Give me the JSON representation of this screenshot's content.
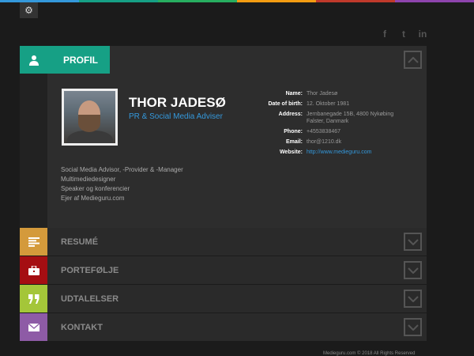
{
  "colors": {
    "topbar": [
      "#3498db",
      "#16a085",
      "#27ae60",
      "#f39c12",
      "#c0392b",
      "#8e44ad"
    ],
    "profil": "#16a085",
    "resume": "#d49a3b",
    "portfolio": "#a50e12",
    "udtalelser": "#a4c639",
    "kontakt": "#8e5ba6"
  },
  "social": {
    "facebook": "f",
    "twitter": "t",
    "linkedin": "in"
  },
  "profile": {
    "tab_label": "PROFIL",
    "name": "THOR JADESØ",
    "title": "PR & Social Media Adviser",
    "info": [
      {
        "key": "Name:",
        "value": "Thor Jadesø"
      },
      {
        "key": "Date of birth:",
        "value": "12. Oktober 1981"
      },
      {
        "key": "Address:",
        "value": "Jernbanegade 15B, 4800 Nykøbing Falster, Danmark"
      },
      {
        "key": "Phone:",
        "value": "+4553838467"
      },
      {
        "key": "Email:",
        "value": "thor@1210.dk"
      },
      {
        "key": "Website:",
        "value": "http://www.medieguru.com"
      }
    ],
    "bio": [
      "Social Media Advisor, -Provider & -Manager",
      "Multimediedesigner",
      "Speaker og konferencier",
      "Ejer af Medieguru.com"
    ]
  },
  "sections": {
    "resume": "RESUMÉ",
    "portfolio": "PORTEFØLJE",
    "udtalelser": "UDTALELSER",
    "kontakt": "KONTAKT"
  },
  "footer": "Medieguru.com © 2018 All Rights Reserved"
}
